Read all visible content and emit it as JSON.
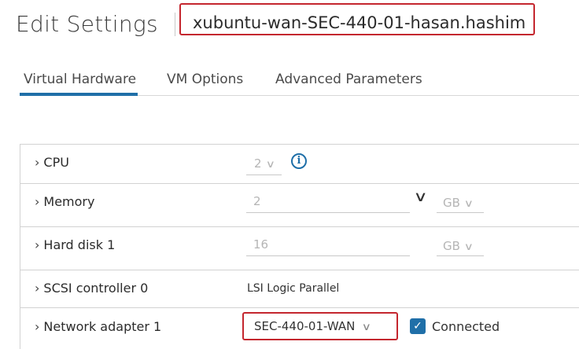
{
  "header": {
    "title": "Edit Settings",
    "vm_name": "xubuntu-wan-SEC-440-01-hasan.hashim"
  },
  "tabs": [
    {
      "label": "Virtual Hardware",
      "active": true
    },
    {
      "label": "VM Options",
      "active": false
    },
    {
      "label": "Advanced Parameters",
      "active": false
    }
  ],
  "hardware": {
    "cpu": {
      "label": "CPU",
      "value": "2",
      "info_icon": "info-icon"
    },
    "memory": {
      "label": "Memory",
      "value": "2",
      "unit": "GB"
    },
    "hard_disk": {
      "label": "Hard disk 1",
      "value": "16",
      "unit": "GB"
    },
    "scsi": {
      "label": "SCSI controller 0",
      "value": "LSI Logic Parallel"
    },
    "network": {
      "label": "Network adapter 1",
      "value": "SEC-440-01-WAN",
      "connected_label": "Connected",
      "connected": true
    }
  },
  "icons": {
    "expand": "chevron-right-icon",
    "dropdown": "chevron-down-icon",
    "check": "checkmark-icon"
  },
  "colors": {
    "accent": "#1f6fa8",
    "highlight_border": "#c4262e"
  }
}
